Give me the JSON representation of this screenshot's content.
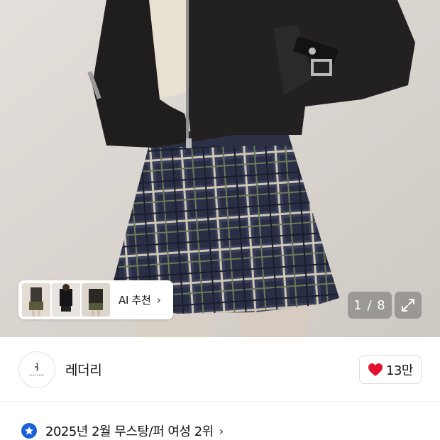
{
  "gallery": {
    "counter_text": "1 / 8",
    "ai_recommend_label": "AI 추천",
    "ai_recommend_chevron": "›",
    "expand_icon": "expand-icon"
  },
  "store": {
    "name": "레더리",
    "logo_icon": "store-logo-icon",
    "likes": "13만",
    "heart_icon": "heart-icon",
    "heart_color": "#e3102f"
  },
  "ranking": {
    "text": "2025년 2월 무스탕/퍼 여성 2위",
    "chevron": "›",
    "badge_icon": "star-badge-icon",
    "badge_color": "#1b5fd9"
  }
}
